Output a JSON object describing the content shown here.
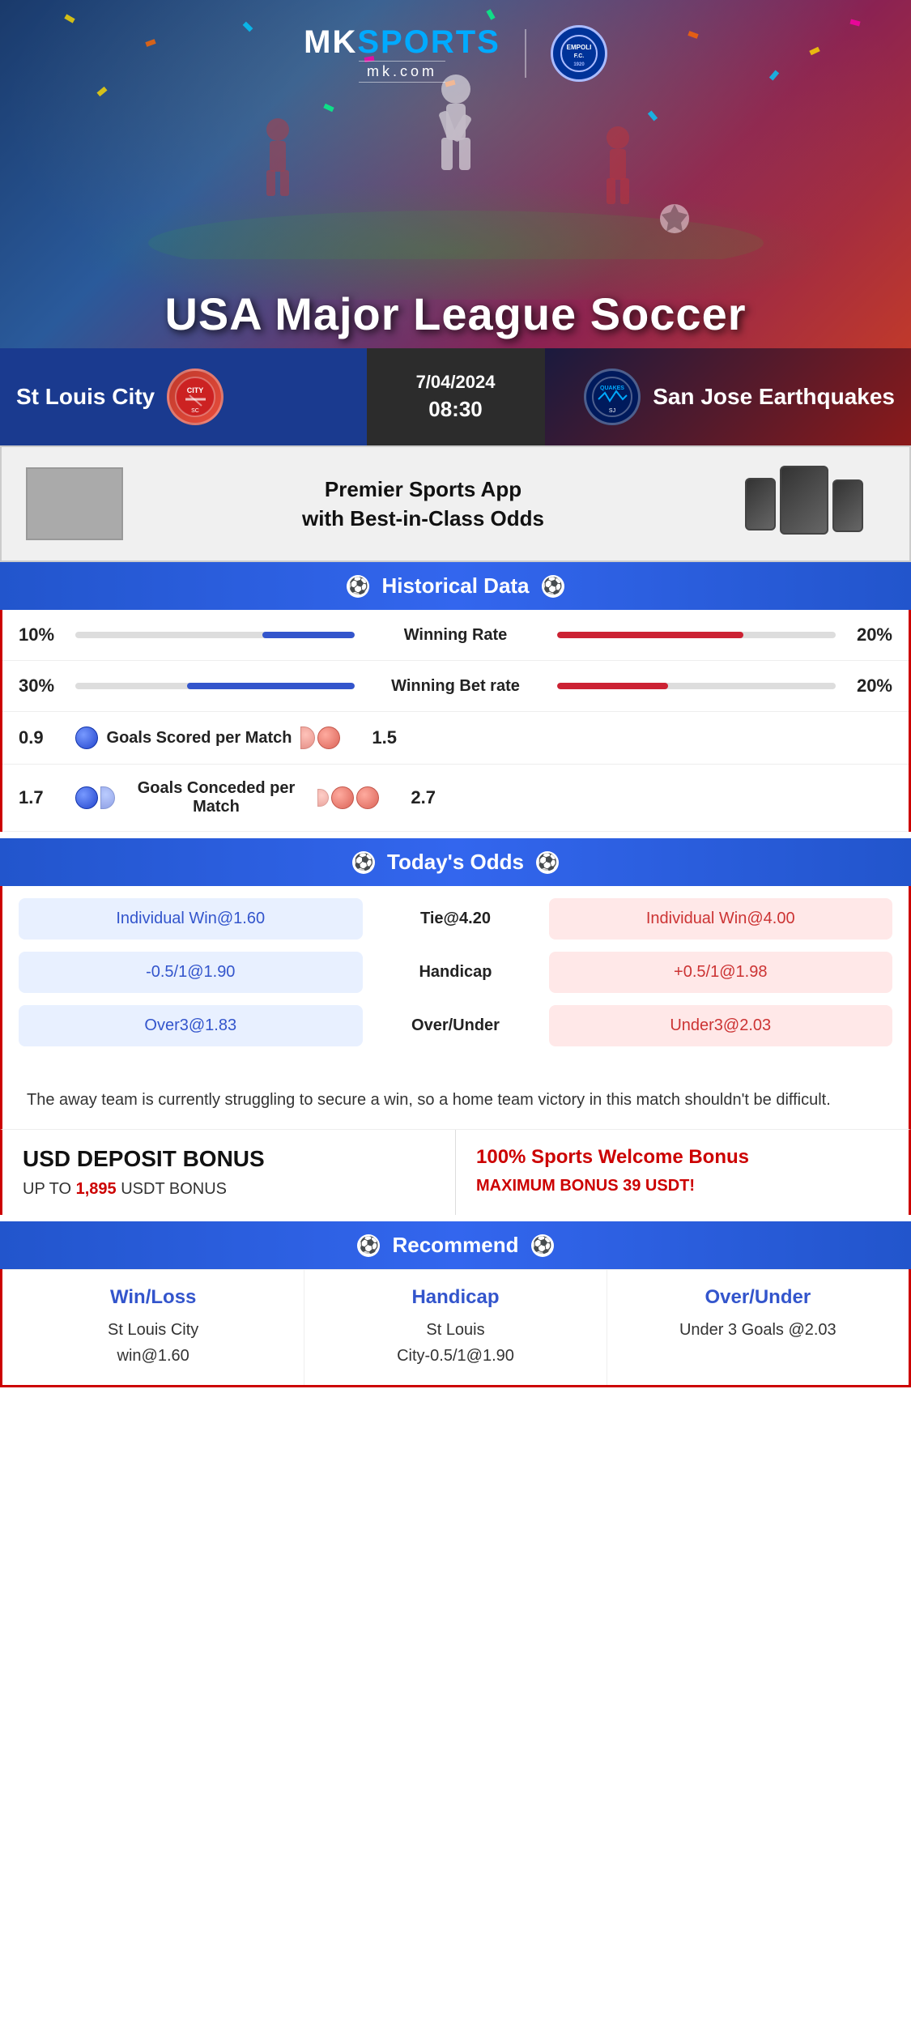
{
  "brand": {
    "name": "MK",
    "sports": "SPORTS",
    "domain": "mk.com",
    "partner_badge": "EMPOLI F.C."
  },
  "hero": {
    "title": "USA Major League Soccer"
  },
  "match": {
    "date": "7/04/2024",
    "time": "08:30",
    "home_team": "St Louis City",
    "away_team": "San Jose Earthquakes",
    "away_team_short": "QUAKES"
  },
  "app_promo": {
    "text": "Premier Sports App\nwith Best-in-Class Odds"
  },
  "historical": {
    "section_title": "Historical Data",
    "stats": [
      {
        "label": "Winning Rate",
        "left_val": "10%",
        "right_val": "20%",
        "left_pct": 33,
        "right_pct": 67
      },
      {
        "label": "Winning Bet rate",
        "left_val": "30%",
        "right_val": "20%",
        "left_pct": 60,
        "right_pct": 40
      },
      {
        "label": "Goals Scored per Match",
        "left_val": "0.9",
        "right_val": "1.5",
        "left_balls": 1,
        "right_balls": 2
      },
      {
        "label": "Goals Conceded per Match",
        "left_val": "1.7",
        "right_val": "2.7",
        "left_balls": 2,
        "right_balls": 3
      }
    ]
  },
  "odds": {
    "section_title": "Today's Odds",
    "rows": [
      {
        "left": "Individual Win@1.60",
        "center": "Tie@4.20",
        "right": "Individual Win@4.00"
      },
      {
        "left": "-0.5/1@1.90",
        "center": "Handicap",
        "right": "+0.5/1@1.98"
      },
      {
        "left": "Over3@1.83",
        "center": "Over/Under",
        "right": "Under3@2.03"
      }
    ]
  },
  "analysis": {
    "text": "The away team is currently struggling to secure a win, so a home team victory in this match shouldn't be difficult."
  },
  "bonus": {
    "left_title": "USD DEPOSIT BONUS",
    "left_sub": "UP TO",
    "left_amount": "1,895",
    "left_currency": "USDT BONUS",
    "right_title_pre": "100%",
    "right_title_post": " Sports Welcome Bonus",
    "right_sub": "MAXIMUM BONUS",
    "right_amount": "39",
    "right_currency": "USDT!"
  },
  "recommend": {
    "section_title": "Recommend",
    "columns": [
      {
        "title": "Win/Loss",
        "detail": "St Louis City\nwin@1.60"
      },
      {
        "title": "Handicap",
        "detail": "St Louis\nCity-0.5/1@1.90"
      },
      {
        "title": "Over/Under",
        "detail": "Under 3 Goals @2.03"
      }
    ]
  }
}
